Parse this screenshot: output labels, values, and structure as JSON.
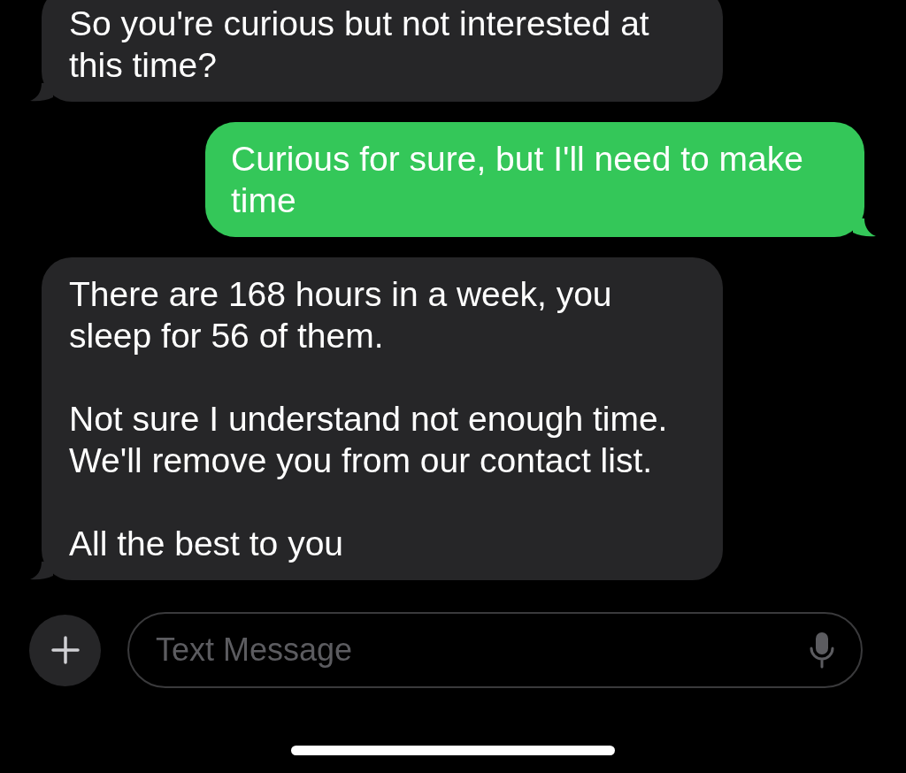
{
  "messages": [
    {
      "kind": "received",
      "text": "So you're curious but not interested at this time?"
    },
    {
      "kind": "sent",
      "text": "Curious for sure, but I'll need to make time"
    },
    {
      "kind": "received",
      "text": "There are 168 hours in a week, you sleep for 56 of them.\n\nNot sure I understand not enough time. We'll remove you from our contact list.\n\nAll the best to you"
    }
  ],
  "composer": {
    "placeholder": "Text Message"
  }
}
